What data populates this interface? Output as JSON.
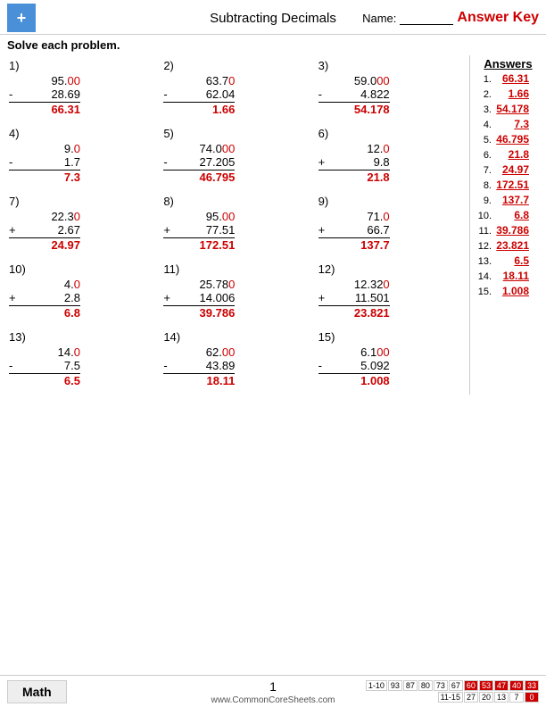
{
  "header": {
    "title": "Subtracting Decimals",
    "name_label": "Name:",
    "answer_key": "Answer Key",
    "logo_symbol": "+"
  },
  "instructions": "Solve each problem.",
  "problems": [
    {
      "num": "1)",
      "top": [
        "9",
        "5",
        ".",
        "0",
        "0"
      ],
      "top_display": "95.00",
      "op": "-",
      "bottom_display": "28.69",
      "bottom": [
        "2",
        "8",
        ".",
        "6",
        "9"
      ],
      "answer": "66.31"
    },
    {
      "num": "2)",
      "top_display": "63.70",
      "op": "-",
      "bottom_display": "62.04",
      "answer": "1.66"
    },
    {
      "num": "3)",
      "top_display": "59.000",
      "op": "-",
      "bottom_display": "4.822",
      "answer": "54.178"
    },
    {
      "num": "4)",
      "top_display": "9.0",
      "op": "-",
      "bottom_display": "1.7",
      "answer": "7.3"
    },
    {
      "num": "5)",
      "top_display": "74.000",
      "op": "-",
      "bottom_display": "27.205",
      "answer": "46.795"
    },
    {
      "num": "6)",
      "top_display": "12.0",
      "op": "+",
      "bottom_display": "9.8",
      "answer": "21.8"
    },
    {
      "num": "7)",
      "top_display": "22.30",
      "op": "+",
      "bottom_display": "2.67",
      "answer": "24.97"
    },
    {
      "num": "8)",
      "top_display": "95.00",
      "op": "+",
      "bottom_display": "77.51",
      "answer": "172.51"
    },
    {
      "num": "9)",
      "top_display": "71.0",
      "op": "+",
      "bottom_display": "66.7",
      "answer": "137.7"
    },
    {
      "num": "10)",
      "top_display": "4.0",
      "op": "+",
      "bottom_display": "2.8",
      "answer": "6.8"
    },
    {
      "num": "11)",
      "top_display": "25.780",
      "op": "+",
      "bottom_display": "14.006",
      "answer": "39.786"
    },
    {
      "num": "12)",
      "top_display": "12.320",
      "op": "+",
      "bottom_display": "11.501",
      "answer": "23.821"
    },
    {
      "num": "13)",
      "top_display": "14.0",
      "op": "-",
      "bottom_display": "7.5",
      "answer": "6.5"
    },
    {
      "num": "14)",
      "top_display": "62.00",
      "op": "-",
      "bottom_display": "43.89",
      "answer": "18.11"
    },
    {
      "num": "15)",
      "top_display": "6.100",
      "op": "-",
      "bottom_display": "5.092",
      "answer": "1.008"
    }
  ],
  "answers": [
    {
      "num": "1.",
      "val": "66.31"
    },
    {
      "num": "2.",
      "val": "1.66"
    },
    {
      "num": "3.",
      "val": "54.178"
    },
    {
      "num": "4.",
      "val": "7.3"
    },
    {
      "num": "5.",
      "val": "46.795"
    },
    {
      "num": "6.",
      "val": "21.8"
    },
    {
      "num": "7.",
      "val": "24.97"
    },
    {
      "num": "8.",
      "val": "172.51"
    },
    {
      "num": "9.",
      "val": "137.7"
    },
    {
      "num": "10.",
      "val": "6.8"
    },
    {
      "num": "11.",
      "val": "39.786"
    },
    {
      "num": "12.",
      "val": "23.821"
    },
    {
      "num": "13.",
      "val": "6.5"
    },
    {
      "num": "14.",
      "val": "18.11"
    },
    {
      "num": "15.",
      "val": "1.008"
    }
  ],
  "footer": {
    "math_label": "Math",
    "url": "www.CommonCoreSheets.com",
    "page": "1",
    "stats": {
      "row1_labels": "1-10",
      "row1_vals": [
        "93",
        "87",
        "80",
        "73",
        "67"
      ],
      "row1_red": [
        "60",
        "53",
        "47",
        "40",
        "33"
      ],
      "row2_labels": "11-15",
      "row2_vals": [
        "27",
        "20",
        "13",
        "7"
      ],
      "row2_red": [
        "0"
      ]
    }
  }
}
